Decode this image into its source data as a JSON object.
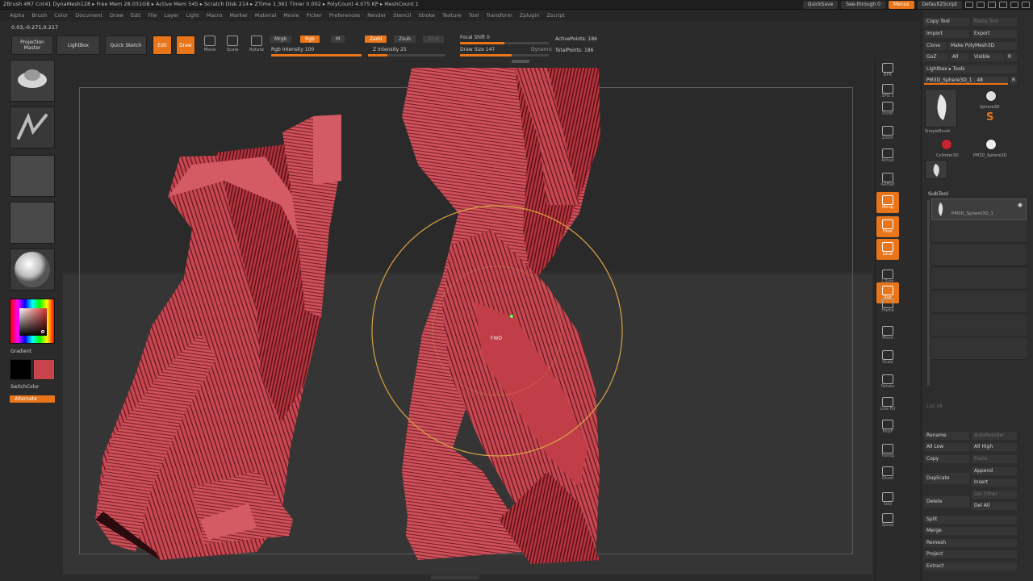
{
  "titlebar": {
    "stats": "ZBrush 4R7 Cnt41   DynaMesh128   ▸ Free Mem 28.031GB ▸ Active Mem 545 ▸ Scratch Disk 214 ▸ ZTime 1.361 Timer 0.002 ▸ PolyCount 4.075 KP ▸ MeshCount 1",
    "quicksave": "QuickSave",
    "see_through": "See-through 0",
    "menus_btn": "Menus",
    "script": "DefaultZScript"
  },
  "menubar": [
    "Alpha",
    "Brush",
    "Color",
    "Document",
    "Draw",
    "Edit",
    "File",
    "Layer",
    "Light",
    "Macro",
    "Marker",
    "Material",
    "Movie",
    "Picker",
    "Preferences",
    "Render",
    "Stencil",
    "Stroke",
    "Texture",
    "Tool",
    "Transform",
    "Zplugin",
    "Zscript"
  ],
  "coords": "0.03,-0.271,0.217",
  "toolshelf": {
    "projection_master": "Projection Master",
    "lightbox": "LightBox",
    "quick_sketch": "Quick Sketch",
    "edit": "Edit",
    "draw": "Draw",
    "move": "Move",
    "scale": "Scale",
    "rotate": "Rotate",
    "mrgb": "Mrgb",
    "rgb": "Rgb",
    "m": "M",
    "zadd": "Zadd",
    "zsub": "Zsub",
    "zcut": "Zcut",
    "rgb_intensity": "Rgb Intensity 100",
    "z_intensity": "Z Intensity 25",
    "focal_shift": "Focal Shift 0",
    "draw_size": "Draw Size 147",
    "dynamic": "Dynamic",
    "active_points": "ActivePoints: 186",
    "total_points": "TotalPoints: 186"
  },
  "left_tray": {
    "gradient": "Gradient",
    "switch_color": "SwitchColor",
    "alternate": "Alternate"
  },
  "cursor_label": "FWD",
  "right_tray": [
    "BPR",
    "SPix 3",
    "Scroll",
    "Zoom",
    "Actual",
    "AAHalf",
    "Persp",
    "Floor",
    "Local",
    "L.Sym",
    "Xyz",
    "Frame",
    "Move",
    "Scale",
    "Rotate",
    "Line Fill",
    "PolyF",
    "Transp",
    "Ghost",
    "Solo",
    "Xpose"
  ],
  "palette": {
    "copy_tool": "Copy Tool",
    "paste_tool": "Paste Tool",
    "import": "Import",
    "export": "Export",
    "clone": "Clone",
    "make_polymesh": "Make PolyMesh3D",
    "goz": "GoZ",
    "all": "All",
    "visible": "Visible",
    "r": "R",
    "lightbox_tools": "Lightbox ▸ Tools",
    "current_tool": "PM3D_Sphere3D_1 . 48",
    "tools": [
      "SimpleBrush",
      "Sphere3D",
      "Cylinder3D",
      "PM3D_Sphere3D",
      "PM3D_Sphere3D_1"
    ],
    "subtool": "SubTool",
    "subtool_item": "PM3D_Sphere3D_1",
    "slots": [
      "",
      "",
      "",
      "",
      "",
      ""
    ],
    "list_all": "List All",
    "rename": "Rename",
    "auto_reorder": "AutoReorder",
    "all_low": "All Low",
    "all_high": "All High",
    "copy": "Copy",
    "paste": "Paste",
    "append": "Append",
    "duplicate": "Duplicate",
    "insert": "Insert",
    "delete": "Delete",
    "del_other": "Del Other",
    "del_all": "Del All",
    "split": "Split",
    "merge": "Merge",
    "remesh": "Remesh",
    "project": "Project",
    "extract": "Extract"
  },
  "colors": {
    "accent": "#e8751a",
    "mesh_red": "#c8434b",
    "mesh_dark": "#6e1a22",
    "brush_ring": "#d9a441"
  }
}
